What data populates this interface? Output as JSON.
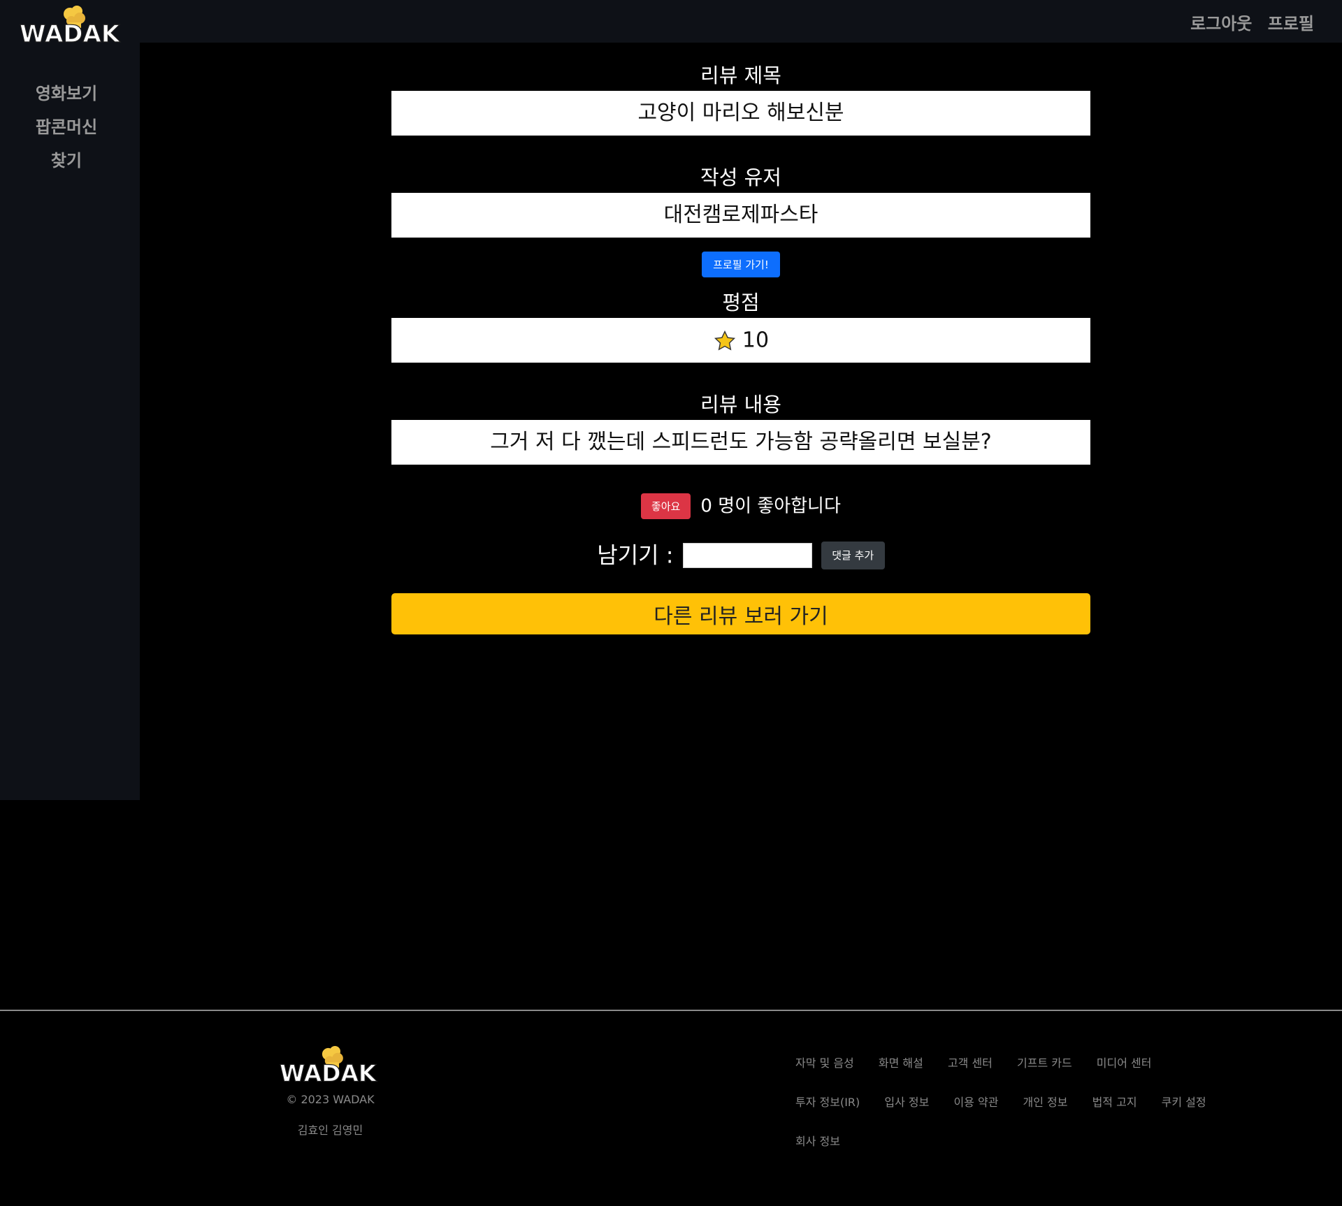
{
  "brand": {
    "logo_text": "WADAK"
  },
  "header": {
    "logout": "로그아웃",
    "profile": "프로필"
  },
  "sidebar": {
    "items": [
      {
        "label": "영화보기"
      },
      {
        "label": "팝콘머신"
      },
      {
        "label": "찾기"
      }
    ]
  },
  "review": {
    "title_label": "리뷰 제목",
    "title_value": "고양이 마리오 해보신분",
    "author_label": "작성 유저",
    "author_value": "대전캠로제파스타",
    "profile_button": "프로필 가기!",
    "rating_label": "평점",
    "rating_value": "10",
    "content_label": "리뷰 내용",
    "content_value": "그거 저 다 깼는데 스피드런도 가능함 공략올리면 보실분?"
  },
  "like": {
    "button": "좋아요",
    "text": "0 명이 좋아합니다"
  },
  "comment": {
    "label": "남기기 :",
    "input_value": "",
    "button": "댓글 추가"
  },
  "other_reviews_button": "다른 리뷰 보러 가기",
  "footer": {
    "copyright": "© 2023 WADAK",
    "names": "김효인 김영민",
    "links_rows": [
      [
        "자막 및 음성",
        "화면 해설",
        "고객 센터",
        "기프트 카드",
        "미디어 센터"
      ],
      [
        "투자 정보(IR)",
        "입사 정보",
        "이용 약관",
        "개인 정보",
        "법적 고지",
        "쿠키 설정"
      ],
      [
        "회사 정보"
      ]
    ]
  },
  "colors": {
    "background": "#000000",
    "sidebar": "#0e1117",
    "primary": "#0d6efd",
    "danger": "#dc3545",
    "dark": "#343a40",
    "warning": "#ffc107",
    "muted": "#9a9a9a",
    "star": "#f5c518"
  },
  "icons": {
    "rating": "star-icon",
    "logo": "popcorn-logo"
  }
}
